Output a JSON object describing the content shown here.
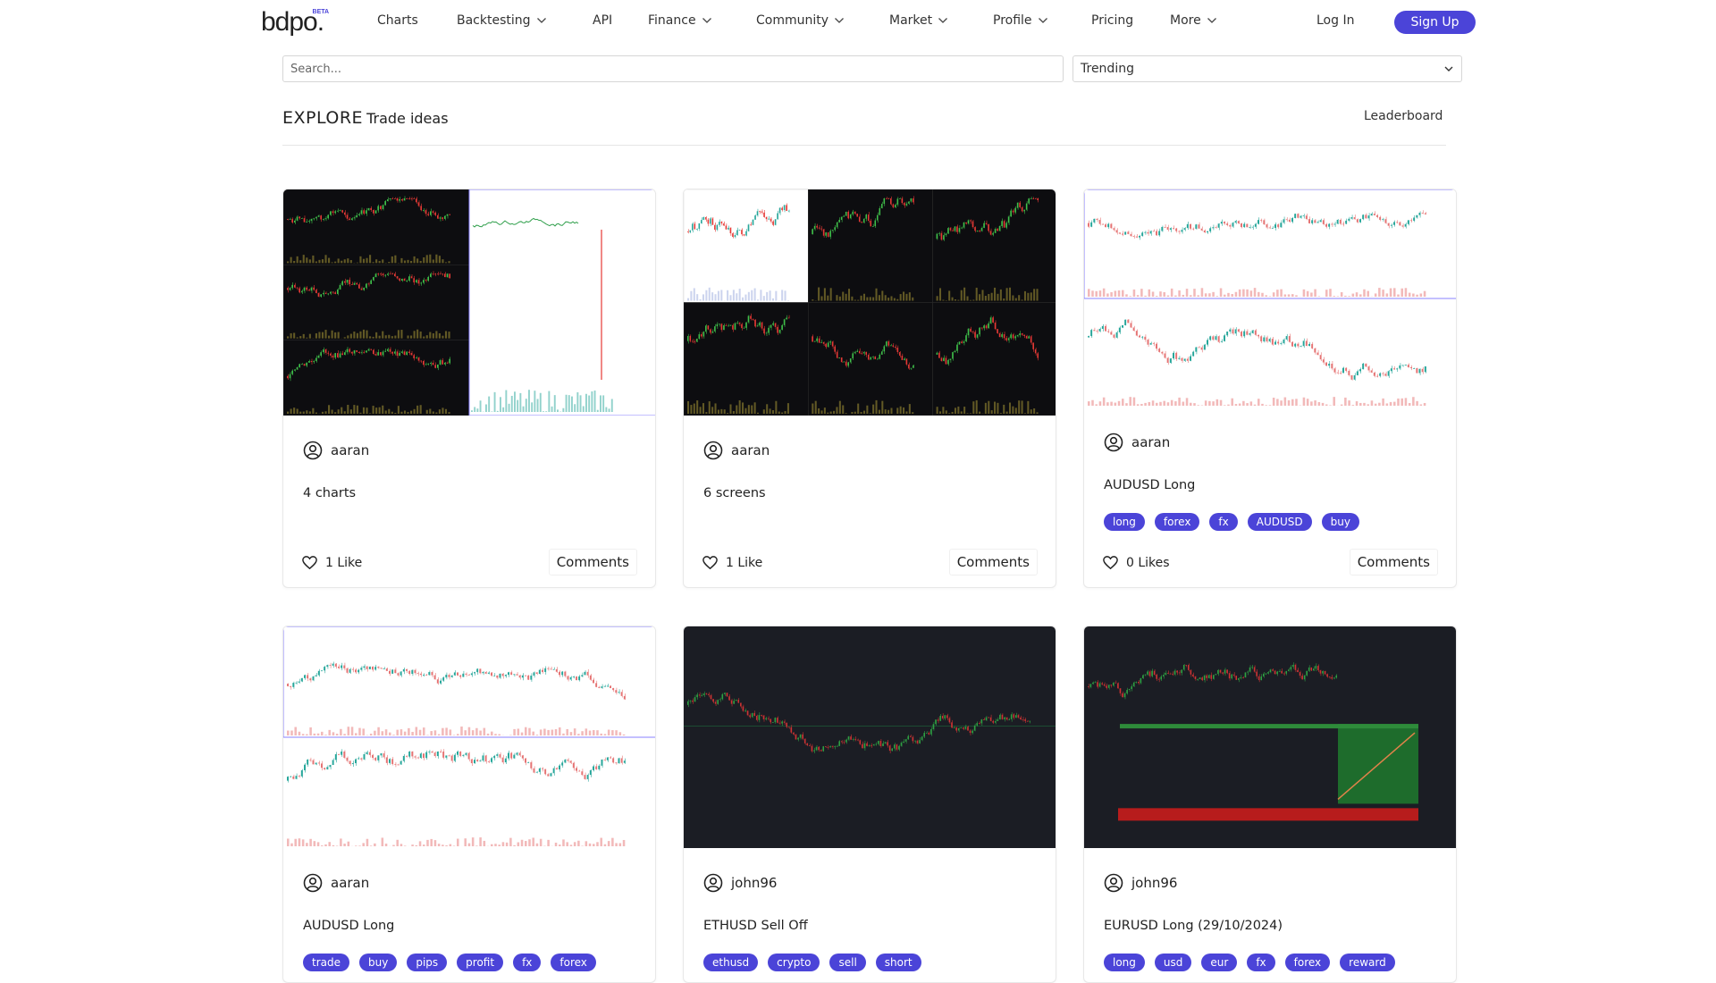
{
  "brand": {
    "logo": "bdpo.",
    "badge": "BETA",
    "accent": "#4b44d8"
  },
  "nav": {
    "items": [
      {
        "label": "Charts",
        "dropdown": false
      },
      {
        "label": "Backtesting",
        "dropdown": true
      },
      {
        "label": "API",
        "dropdown": false
      },
      {
        "label": "Finance",
        "dropdown": true
      },
      {
        "label": "Community",
        "dropdown": true
      },
      {
        "label": "Market",
        "dropdown": true
      },
      {
        "label": "Profile",
        "dropdown": true
      },
      {
        "label": "Pricing",
        "dropdown": false
      },
      {
        "label": "More",
        "dropdown": true
      }
    ],
    "login": "Log In",
    "signup": "Sign Up"
  },
  "search": {
    "placeholder": "Search..."
  },
  "sort": {
    "selected": "Trending"
  },
  "explore": {
    "title": "EXPLORE",
    "subtitle": "Trade ideas",
    "leaderboard": "Leaderboard"
  },
  "cards": [
    {
      "author": "aaran",
      "title": "4 charts",
      "tags": [],
      "likes": "1 Like",
      "comments": "Comments",
      "image_theme": "mixed-4"
    },
    {
      "author": "aaran",
      "title": "6 screens",
      "tags": [],
      "likes": "1 Like",
      "comments": "Comments",
      "image_theme": "dark-6"
    },
    {
      "author": "aaran",
      "title": "AUDUSD Long",
      "tags": [
        "long",
        "forex",
        "fx",
        "AUDUSD",
        "buy"
      ],
      "likes": "0 Likes",
      "comments": "Comments",
      "image_theme": "light-2"
    },
    {
      "author": "aaran",
      "title": "AUDUSD Long",
      "tags": [
        "trade",
        "buy",
        "pips",
        "profit",
        "fx",
        "forex"
      ],
      "likes": "",
      "comments": "",
      "image_theme": "light-2"
    },
    {
      "author": "john96",
      "title": "ETHUSD Sell Off",
      "tags": [
        "ethusd",
        "crypto",
        "sell",
        "short"
      ],
      "likes": "",
      "comments": "",
      "image_theme": "dark-1"
    },
    {
      "author": "john96",
      "title": "EURUSD Long (29/10/2024)",
      "tags": [
        "long",
        "usd",
        "eur",
        "fx",
        "forex",
        "reward"
      ],
      "likes": "",
      "comments": "",
      "image_theme": "dark-position"
    }
  ],
  "icons": {
    "user": "user-circle-icon",
    "heart": "heart-icon",
    "chevron": "chevron-down-icon"
  }
}
